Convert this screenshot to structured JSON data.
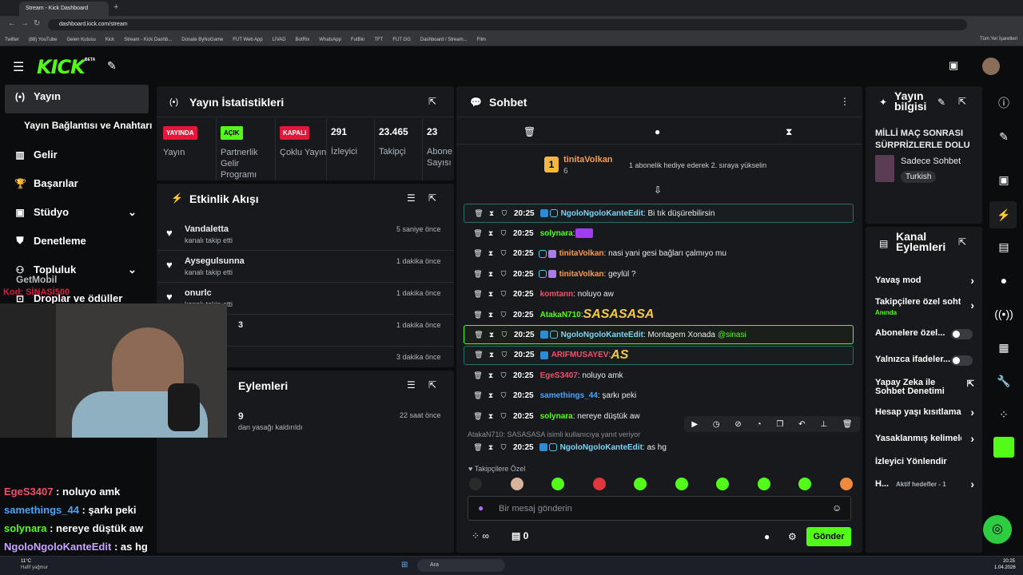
{
  "browser": {
    "tab_title": "Stream - Kick Dashboard",
    "new_tab": "+",
    "url": "dashboard.kick.com/stream",
    "bookmarks": [
      "Twitter",
      "(88) YouTube",
      "Gelen Kutusu",
      "Kick",
      "Stream - Kick Dashb...",
      "Donate ByNoGame",
      "FUT Web App",
      "LİVAD",
      "BotRix",
      "WhatsApp",
      "FutBin",
      "TFT",
      "FUT GG",
      "Dashboard / Stream...",
      "Film"
    ],
    "all_bookmarks": "Tüm Yer İşaretleri"
  },
  "brand": {
    "logo": "KICK",
    "beta": "BETA"
  },
  "sidebar": {
    "items": [
      {
        "label": "Yayın",
        "icon": "broadcast-icon"
      },
      {
        "label": "Yayın Bağlantısı ve Anahtarı",
        "icon": ""
      },
      {
        "label": "Gelir",
        "icon": "chart-icon"
      },
      {
        "label": "Başarılar",
        "icon": "trophy-icon"
      },
      {
        "label": "Stüdyo",
        "icon": "studio-icon"
      },
      {
        "label": "Denetleme",
        "icon": "shield-icon"
      },
      {
        "label": "Topluluk",
        "icon": "community-icon"
      },
      {
        "label": "Droplar ve ödüller",
        "icon": "gift-icon"
      }
    ]
  },
  "stats": {
    "title": "Yayın İstatistikleri",
    "items": [
      {
        "badge": "YAYINDA",
        "label": "Yayın",
        "color": "#e6163a"
      },
      {
        "badge": "AÇIK",
        "label": "Partnerlik Gelir Programı",
        "color": "#53fc18"
      },
      {
        "badge": "KAPALI",
        "label": "Çoklu Yayın",
        "color": "#e6163a"
      },
      {
        "value": "291",
        "label": "İzleyici"
      },
      {
        "value": "23.465",
        "label": "Takipçi"
      },
      {
        "value": "23",
        "label": "Abone Sayısı"
      }
    ]
  },
  "activity": {
    "title": "Etkinlik Akışı",
    "rows": [
      {
        "user": "Vandaletta",
        "action": "kanalı takip etti",
        "time": "5 saniye önce"
      },
      {
        "user": "Aysegulsunna",
        "action": "kanalı takip etti",
        "time": "1 dakika önce"
      },
      {
        "user": "onurlc",
        "action": "kanalı takip etti",
        "time": "1 dakika önce"
      },
      {
        "user": "3",
        "action": "",
        "time": "1 dakika önce"
      },
      {
        "user": "",
        "action": "",
        "time": "3 dakika önce"
      }
    ]
  },
  "mod_actions": {
    "title": "Eylemleri",
    "user": "9",
    "action": "dan yasağı kaldırıldı",
    "time": "22 saat önce"
  },
  "chat": {
    "title": "Sohbet",
    "pinned_user": "tinitaVolkan",
    "pinned_count": "6",
    "pinned_rank": "1",
    "pinned_text": "1 abonelik hediye ederek 2. sıraya yükselin",
    "messages": [
      {
        "time": "20:25",
        "user": "NgoloNgoloKanteEdit",
        "color": "#7cd4f5",
        "text": ": Bi tık düşürebilirsin",
        "style": "hl2"
      },
      {
        "time": "20:25",
        "user": "solynara",
        "color": "#53fc18",
        "text": ": ",
        "emote": "purple"
      },
      {
        "time": "20:25",
        "user": "tinitaVolkan",
        "color": "#f89d4c",
        "text": ": nasi yani gesi bağları çalmıyo mu"
      },
      {
        "time": "20:25",
        "user": "tinitaVolkan",
        "color": "#f89d4c",
        "text": ": geylül ?"
      },
      {
        "time": "20:25",
        "user": "komtann",
        "color": "#f24f6c",
        "text": ": noluyo aw"
      },
      {
        "time": "20:25",
        "user": "AtakaN710",
        "color": "#53fc18",
        "text": ": ",
        "emote": "SASASASA"
      },
      {
        "time": "20:25",
        "user": "NgoloNgoloKanteEdit",
        "color": "#7cd4f5",
        "text": ": Montagem Xonada ",
        "mention": "@sinasi",
        "style": "hl"
      },
      {
        "time": "20:25",
        "user": "ARIFMUSAYEV",
        "color": "#f24f6c",
        "text": ": ",
        "emote": "AS",
        "style": "hl2"
      },
      {
        "time": "20:25",
        "user": "EgeS3407",
        "color": "#f24f6c",
        "text": ": noluyo amk"
      },
      {
        "time": "20:25",
        "user": "samethings_44",
        "color": "#4ea3f5",
        "text": ": şarkı peki"
      },
      {
        "time": "20:25",
        "user": "solynara",
        "color": "#53fc18",
        "text": ": nereye düştük aw"
      }
    ],
    "reply_to": "AtakaN710: SASASASA isimli kullanıcıya yanıt veriyor",
    "last": {
      "time": "20:25",
      "user": "NgoloNgoloKanteEdit",
      "color": "#7cd4f5",
      "text": ": as hg"
    },
    "followers_only": "Takipçilere Özel",
    "placeholder": "Bir mesaj gönderin",
    "points": "∞",
    "count": "0",
    "send": "Gönder"
  },
  "stream_info": {
    "title": "Yayın bilgisi",
    "stream_title": "MİLLİ MAÇ SONRASI SÜRPRİZLERLE DOLU ...",
    "category": "Sadece Sohbet",
    "language": "Turkish"
  },
  "channel_actions": {
    "title": "Kanal Eylemleri",
    "items": [
      {
        "label": "Yavaş mod",
        "type": "chevron"
      },
      {
        "label": "Takipçilere özel soht",
        "sub": "Anında",
        "type": "chevron"
      },
      {
        "label": "Abonelere özel...",
        "type": "toggle"
      },
      {
        "label": "Yalnızca ifadeler...",
        "type": "toggle"
      },
      {
        "label": "Yapay Zeka ile Sohbet Denetimi",
        "type": "external"
      },
      {
        "label": "Hesap yaşı kısıtlama",
        "type": "chevron"
      },
      {
        "label": "Yasaklanmış kelimele",
        "type": "chevron"
      },
      {
        "label": "İzleyici Yönlendir",
        "type": "none"
      },
      {
        "label": "H...",
        "sub": "Aktif hedefler - 1",
        "type": "chevron"
      }
    ]
  },
  "overlay": {
    "brand": "GetMobil",
    "code": "Kod: SİNASİ500",
    "lines": [
      {
        "user": "EgeS3407",
        "text": " : noluyo amk",
        "color": "#f24f6c"
      },
      {
        "user": "samethings_44",
        "text": " : şarkı peki",
        "color": "#4ea3f5"
      },
      {
        "user": "solynara",
        "text": " : nereye düştük aw",
        "color": "#53fc18"
      },
      {
        "user": "NgoloNgoloKanteEdit",
        "text": " : as hg",
        "color": "#c9a4ff"
      }
    ]
  },
  "taskbar": {
    "temp": "11°C",
    "weather": "Hafif yağmur",
    "search": "Ara",
    "time": "20:25",
    "date": "1.04.2026"
  }
}
